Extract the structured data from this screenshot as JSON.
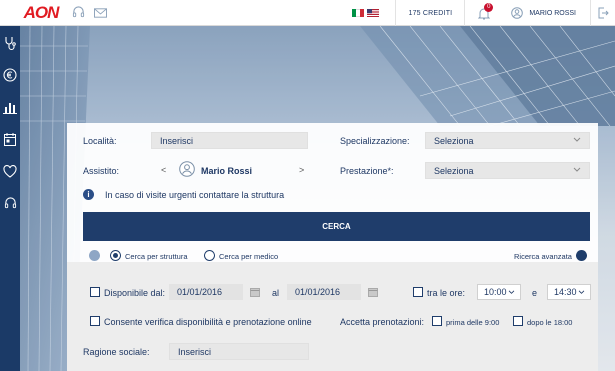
{
  "brand": {
    "logo_text": "AON",
    "accent": "#e11b22",
    "navy": "#1f3d6b"
  },
  "topbar": {
    "icons": [
      "headset-icon",
      "mail-icon"
    ],
    "flags": [
      "italy-flag",
      "usa-flag"
    ],
    "credits": "175 CREDITI",
    "notifications_count": "0",
    "user_name": "MARIO ROSSI"
  },
  "sidebar": {
    "items": [
      "stethoscope-icon",
      "euro-icon",
      "chart-icon",
      "calendar-icon",
      "heart-icon",
      "headset-icon"
    ]
  },
  "form": {
    "localita_label": "Località:",
    "localita_value": "Inserisci",
    "specializzazione_label": "Specializzazione:",
    "specializzazione_value": "Seleziona",
    "assistito_label": "Assistito:",
    "assistito_prev": "<",
    "assistito_name": "Mario Rossi",
    "assistito_next": ">",
    "prestazione_label": "Prestazione*:",
    "prestazione_value": "Seleziona",
    "info_icon": "i",
    "info_text": "In caso di visite urgenti contattare la struttura",
    "cerca_button": "CERCA",
    "radio_struttura": "Cerca per struttura",
    "radio_medico": "Cerca per medico",
    "ricerca_avanzata": "Ricerca avanzata"
  },
  "advanced": {
    "disponibile_label": "Disponibile dal:",
    "date_from": "01/01/2016",
    "al_label": "al",
    "date_to": "01/01/2016",
    "tra_le_ore_label": "tra le ore:",
    "time_from": "10:00",
    "e_label": "e",
    "time_to": "14:30",
    "consente_label": "Consente verifica disponibilità e prenotazione online",
    "accetta_label": "Accetta prenotazioni:",
    "prima_label": "prima delle 9:00",
    "dopo_label": "dopo le 18:00",
    "ragione_label": "Ragione sociale:",
    "ragione_value": "Inserisci"
  }
}
